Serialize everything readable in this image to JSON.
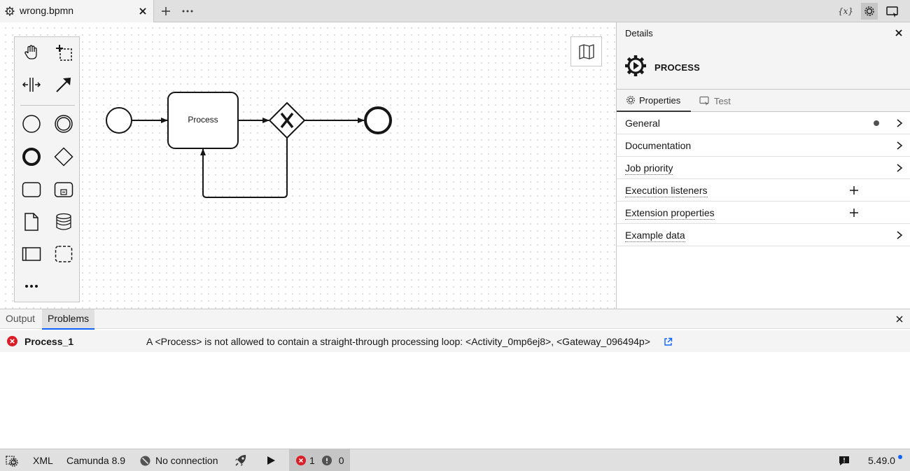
{
  "tabbar": {
    "file_tab_label": "wrong.bpmn",
    "variables_label": "{x}"
  },
  "diagram": {
    "task_label": "Process"
  },
  "properties_panel": {
    "title": "Details",
    "element_type": "PROCESS",
    "tabs": [
      {
        "label": "Properties"
      },
      {
        "label": "Test"
      }
    ],
    "groups": [
      {
        "label": "General"
      },
      {
        "label": "Documentation"
      },
      {
        "label": "Job priority"
      },
      {
        "label": "Execution listeners"
      },
      {
        "label": "Extension properties"
      },
      {
        "label": "Example data"
      }
    ]
  },
  "bottom_panel": {
    "tabs": [
      {
        "label": "Output"
      },
      {
        "label": "Problems"
      }
    ],
    "problems": [
      {
        "element": "Process_1",
        "message": "A <Process> is not allowed to contain a straight-through processing loop: <Activity_0mp6ej8>, <Gateway_096494p>"
      }
    ]
  },
  "statusbar": {
    "xml_label": "XML",
    "engine_label": "Camunda 8.9",
    "connection_label": "No connection",
    "error_count": "1",
    "warning_count": "0",
    "version": "5.49.0"
  },
  "colors": {
    "error": "#da1e28",
    "accent": "#0f62fe"
  }
}
